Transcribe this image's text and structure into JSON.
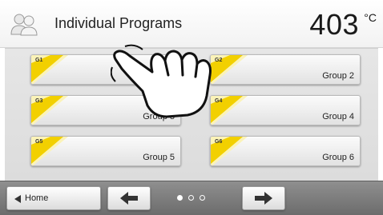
{
  "header": {
    "title": "Individual Programs",
    "temperature": "403",
    "unit": "°C",
    "icon": "user-group-icon"
  },
  "programs": [
    {
      "code": "G1",
      "name": ""
    },
    {
      "code": "G2",
      "name": "Group 2"
    },
    {
      "code": "G3",
      "name": "Group 3"
    },
    {
      "code": "G4",
      "name": "Group 4"
    },
    {
      "code": "G5",
      "name": "Group 5"
    },
    {
      "code": "G6",
      "name": "Group 6"
    }
  ],
  "footer": {
    "home_label": "Home",
    "page_indicator": {
      "current": 1,
      "total": 3
    }
  },
  "colors": {
    "accent_yellow": "#f2d000",
    "footer_bg": "#7a7a7a"
  },
  "overlay": {
    "icon": "pointing-hand-icon"
  }
}
